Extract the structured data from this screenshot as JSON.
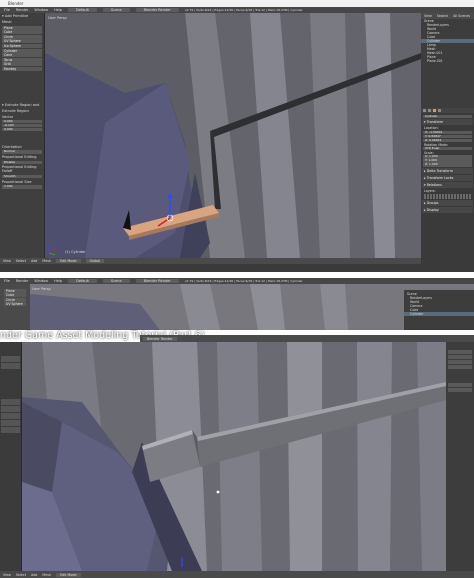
{
  "app": {
    "window_title": "Blender"
  },
  "top": {
    "menu": [
      "File",
      "Render",
      "Window",
      "Help"
    ],
    "layout": "Default",
    "scene": "Scene",
    "engine": "Blender Render",
    "stats": "v2.79 | Verts:8/24 | Edges:12/36 | Faces:6/18 | Tris:12 | Mem:18.23M | Cylinder",
    "viewport_label": "User Persp",
    "object_label": "(1) Cylinder",
    "toolshelf": {
      "header": "▾ Add Primitive",
      "sections": [
        "Mesh:"
      ],
      "buttons": [
        "Plane",
        "Cube",
        "Circle",
        "UV Sphere",
        "Ico Sphere",
        "Cylinder",
        "Cone",
        "Torus",
        "Grid",
        "Monkey"
      ],
      "extrude": {
        "header": "▾ Extrude Region and",
        "label": "Extrude Region",
        "orientation_label": "Orientation",
        "orientation_value": "Normal",
        "prop_label": "Proportional Editing",
        "prop_value": "Disable",
        "falloff_label": "Proportional Editing Falloff",
        "falloff_value": "Smooth",
        "size_label": "Proportional Size",
        "size_value": "1.000",
        "vector_label": "Vector",
        "vector_values": [
          "0.000",
          "-0.103",
          "0.000"
        ]
      }
    },
    "bottom_menu": [
      "View",
      "Select",
      "Add",
      "Mesh",
      "Edit Mode",
      "Global"
    ],
    "outliner": {
      "menu": [
        "View",
        "Search",
        "All Scenes"
      ],
      "items": [
        "Scene",
        "RenderLayers",
        "World",
        "Camera",
        "Cube",
        "Cylinder",
        "Lamp",
        "Mesh",
        "Mesh.001",
        "Plane",
        "Plane.001"
      ],
      "selected": 5
    },
    "properties": {
      "object_name": "Cylinder",
      "transform_header": "▾ Transform",
      "location_label": "Location:",
      "location": [
        "X: -1.59041",
        "Y: 0.84847",
        "Z: 0.06021"
      ],
      "rotation_label": "Rotation Mode:",
      "rotation_mode": "XYZ Euler",
      "scale_label": "Scale:",
      "scale": [
        "X: 1.000",
        "Y: 1.000",
        "Z: 1.000"
      ],
      "sections": [
        "▸ Delta Transform",
        "▸ Transform Locks",
        "▾ Relations",
        "▸ Groups",
        "▸ Display"
      ],
      "layers_label": "Layers:"
    }
  },
  "bottom": {
    "menu": [
      "File",
      "Render",
      "Window",
      "Help"
    ],
    "layout": "Default",
    "scene": "Scene",
    "engine": "Blender Render",
    "stats": "v2.79 | Verts:8/24 | Edges:12/36 | Faces:6/18 | Tris:12 | Mem:18.23M | Cylinder",
    "viewport_label": "User Persp",
    "title_overlay": "nder Game Asset Modeling Tutorial (Part 6)",
    "inner_engine": "Blender Render",
    "inner_outliner_items": [
      "Scene",
      "RenderLayers",
      "World",
      "Camera",
      "Cube",
      "Cylinder"
    ],
    "inner_toolshelf": [
      "Plane",
      "Cube",
      "Circle",
      "UV Sphere"
    ],
    "bottom_menu": [
      "View",
      "Select",
      "Add",
      "Mesh",
      "Edit Mode"
    ]
  },
  "colors": {
    "ui_dark": "#3d3d3d",
    "viewport_bg": "#6e6e76",
    "selection": "#5a6b7a",
    "plank": "#d9a580",
    "axis_blue": "#2a4cff",
    "axis_red": "#d62020",
    "axis_green": "#27b327"
  }
}
